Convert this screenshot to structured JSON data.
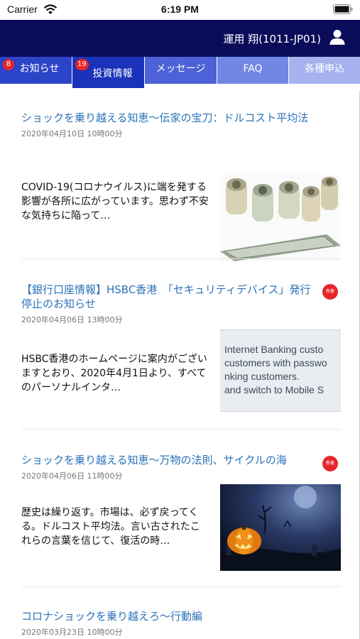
{
  "status_bar": {
    "carrier": "Carrier",
    "time": "6:19 PM"
  },
  "header": {
    "user_name": "運用 翔(1011-JP01)"
  },
  "tabs": [
    {
      "label": "お知らせ",
      "badge": "8",
      "color": "#2b44c8"
    },
    {
      "label": "投資情報",
      "badge": "19",
      "color": "#1b33b8"
    },
    {
      "label": "メッセージ",
      "badge": "",
      "color": "#4c62d6"
    },
    {
      "label": "FAQ",
      "badge": "",
      "color": "#7287e4"
    },
    {
      "label": "各種申込",
      "badge": "",
      "color": "#a5b2ee"
    }
  ],
  "news": [
    {
      "title": "ショックを乗り越える知恵〜伝家の宝刀：ドルコスト平均法",
      "date": "2020年04月10日 10時00分",
      "excerpt": "COVID-19(コロナウイルス)に端を発する影響が各所に広がっています。思わず不安な気持ちに陥って…",
      "badge": "",
      "thumb": "dollar-rolls"
    },
    {
      "title": "【銀行口座情報】HSBC香港　「セキュリティデバイス」発行停止のお知らせ",
      "date": "2020年04月06日 13時00分",
      "excerpt": "HSBC香港のホームページに案内がございますとおり、2020年4月1日より、すべてのパーソナルインタ…",
      "badge": "新着",
      "thumb_lines": [
        "Internet Banking custo",
        "customers with passwo",
        "nking customers.",
        "and switch to Mobile S"
      ]
    },
    {
      "title": "ショックを乗り越える知恵〜万物の法則、サイクルの海",
      "date": "2020年04月06日 11時00分",
      "excerpt": "歴史は繰り返す。市場は、必ず戻ってくる。ドルコスト平均法。言い古されたこれらの言葉を信じて、復活の時…",
      "badge": "新着",
      "thumb": "halloween"
    },
    {
      "title": "コロナショックを乗り越えろ〜行動編",
      "date": "2020年03月23日 10時00分",
      "excerpt": "",
      "badge": ""
    }
  ]
}
